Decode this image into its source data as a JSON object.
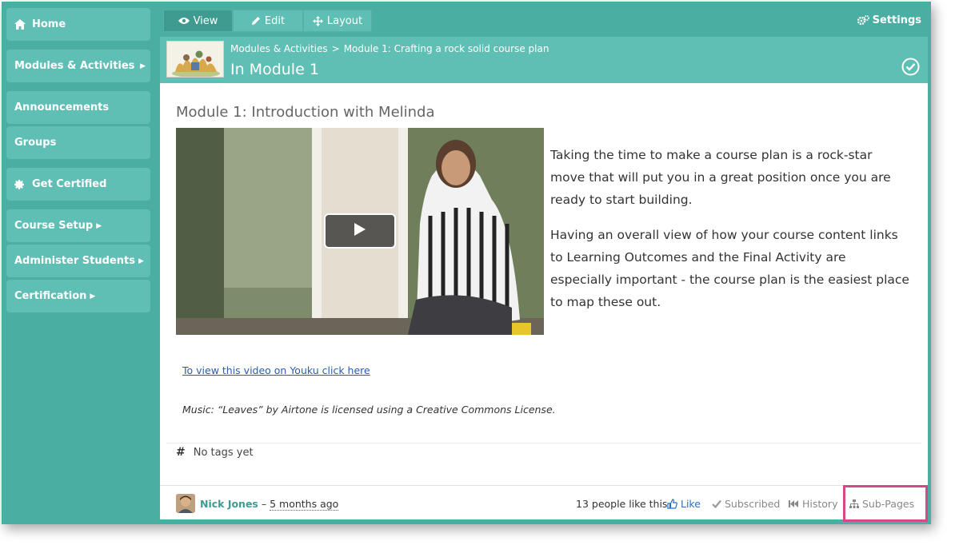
{
  "sidebar": {
    "items": [
      {
        "label": "Home",
        "icon": "home-icon"
      },
      {
        "label": "Modules & Activities",
        "icon": "caret-right-icon"
      },
      {
        "label": "Announcements"
      },
      {
        "label": "Groups"
      },
      {
        "label": "Get Certified",
        "icon": "badge-icon"
      },
      {
        "label": "Course Setup",
        "icon": "caret-right-icon"
      },
      {
        "label": "Administer Students",
        "icon": "caret-right-icon"
      },
      {
        "label": "Certification",
        "icon": "caret-right-icon"
      }
    ]
  },
  "toolbar": {
    "view_label": "View",
    "edit_label": "Edit",
    "layout_label": "Layout",
    "settings_label": "Settings",
    "active": "View"
  },
  "header": {
    "breadcrumb": [
      "Modules & Activities",
      "Module 1: Crafting a rock solid course plan"
    ],
    "breadcrumb_sep": ">",
    "title": "In Module 1"
  },
  "content": {
    "module_title": "Module 1: Introduction with Melinda",
    "paragraphs": [
      "Taking the time to make a course plan is a rock-star move that will put you in a great position once you are ready to start building.",
      "Having an overall view of how your course content links to Learning Outcomes and the Final Activity are especially important - the course plan is the easiest place to map these out."
    ],
    "youku_link": "To view this video on Youku click here",
    "music_credit": "Music: “Leaves” by Airtone is licensed using a Creative Commons License.",
    "tags_text": "No tags yet"
  },
  "footer": {
    "author": "Nick Jones",
    "separator": " – ",
    "time": "5 months ago",
    "likes_count": "13 people like this",
    "like_label": "Like",
    "subscribed_label": "Subscribed",
    "history_label": "History",
    "subpages_label": "Sub-Pages"
  },
  "colors": {
    "frame": "#4aaea3",
    "nav_bg": "#5fbfb4",
    "active_tab": "#3f9b90",
    "link": "#2a5db0",
    "author": "#3d9c91",
    "highlight": "#d6488a"
  }
}
